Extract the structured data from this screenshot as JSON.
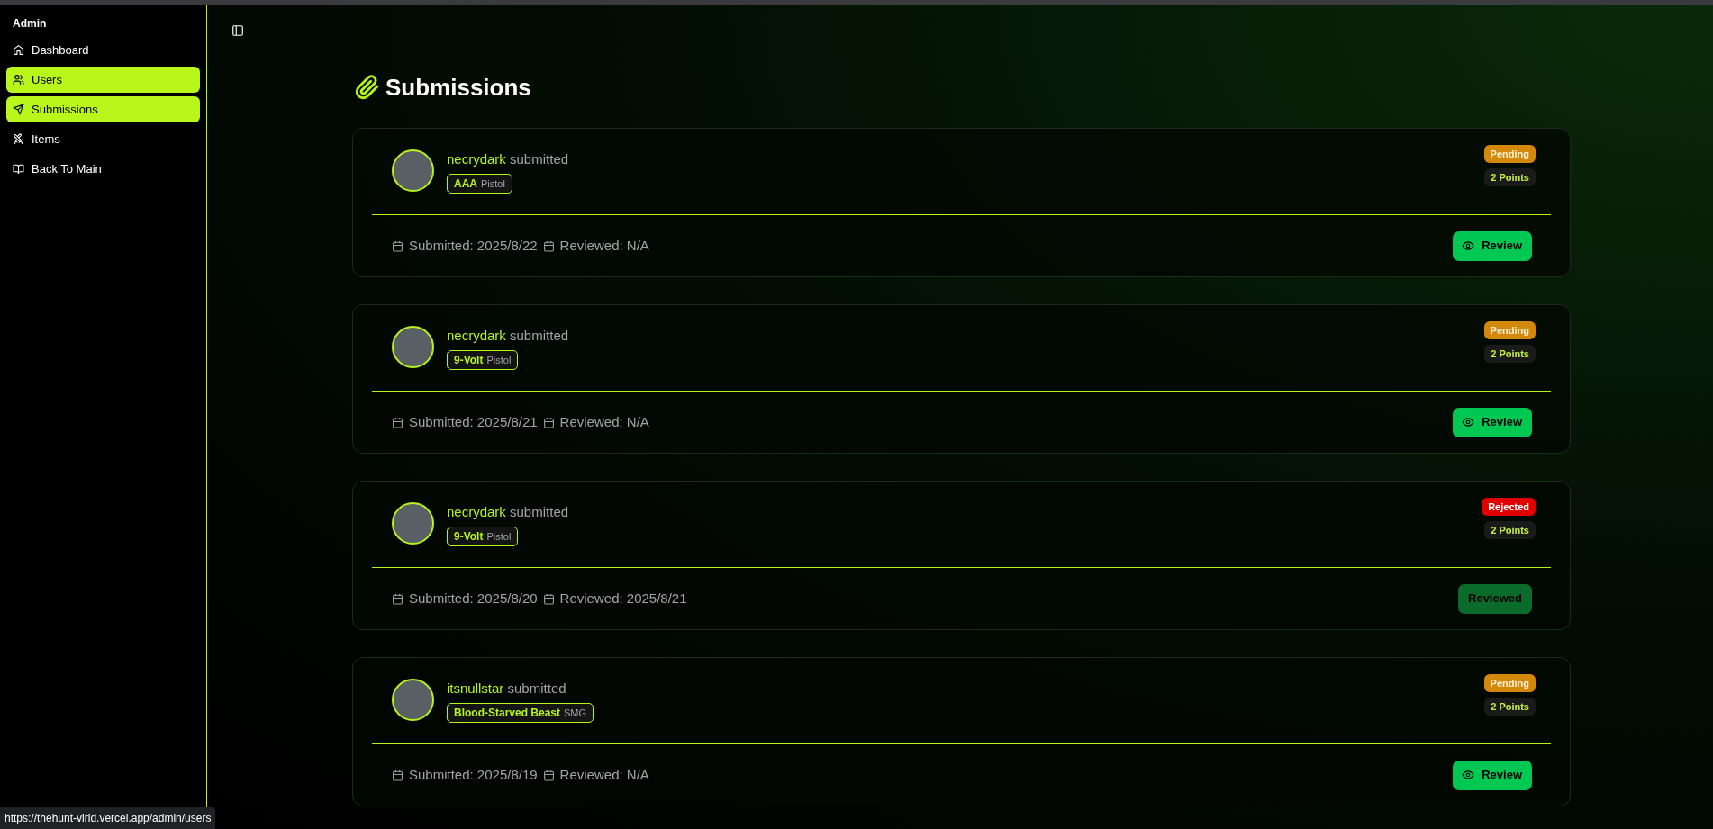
{
  "sidebar": {
    "title": "Admin",
    "items": [
      {
        "label": "Dashboard",
        "selected": false
      },
      {
        "label": "Users",
        "selected": true
      },
      {
        "label": "Submissions",
        "selected": true
      },
      {
        "label": "Items",
        "selected": false
      },
      {
        "label": "Back To Main",
        "selected": false
      }
    ]
  },
  "page": {
    "title": "Submissions"
  },
  "submissions": [
    {
      "user": "necrydark",
      "verb": "submitted",
      "item": "AAA",
      "category": "Pistol",
      "status": {
        "label": "Pending",
        "kind": "pending"
      },
      "points": "2 Points",
      "submitted": "Submitted: 2025/8/22",
      "reviewed": "Reviewed: N/A",
      "action": {
        "label": "Review",
        "kind": "review"
      }
    },
    {
      "user": "necrydark",
      "verb": "submitted",
      "item": "9-Volt",
      "category": "Pistol",
      "status": {
        "label": "Pending",
        "kind": "pending"
      },
      "points": "2 Points",
      "submitted": "Submitted: 2025/8/21",
      "reviewed": "Reviewed: N/A",
      "action": {
        "label": "Review",
        "kind": "review"
      }
    },
    {
      "user": "necrydark",
      "verb": "submitted",
      "item": "9-Volt",
      "category": "Pistol",
      "status": {
        "label": "Rejected",
        "kind": "rejected"
      },
      "points": "2 Points",
      "submitted": "Submitted: 2025/8/20",
      "reviewed": "Reviewed: 2025/8/21",
      "action": {
        "label": "Reviewed",
        "kind": "reviewed"
      }
    },
    {
      "user": "itsnullstar",
      "verb": "submitted",
      "item": "Blood-Starved Beast",
      "category": "SMG",
      "status": {
        "label": "Pending",
        "kind": "pending"
      },
      "points": "2 Points",
      "submitted": "Submitted: 2025/8/19",
      "reviewed": "Reviewed: N/A",
      "action": {
        "label": "Review",
        "kind": "review"
      }
    }
  ],
  "status_bar": {
    "url": "https://thehunt-virid.vercel.app/admin/users"
  }
}
